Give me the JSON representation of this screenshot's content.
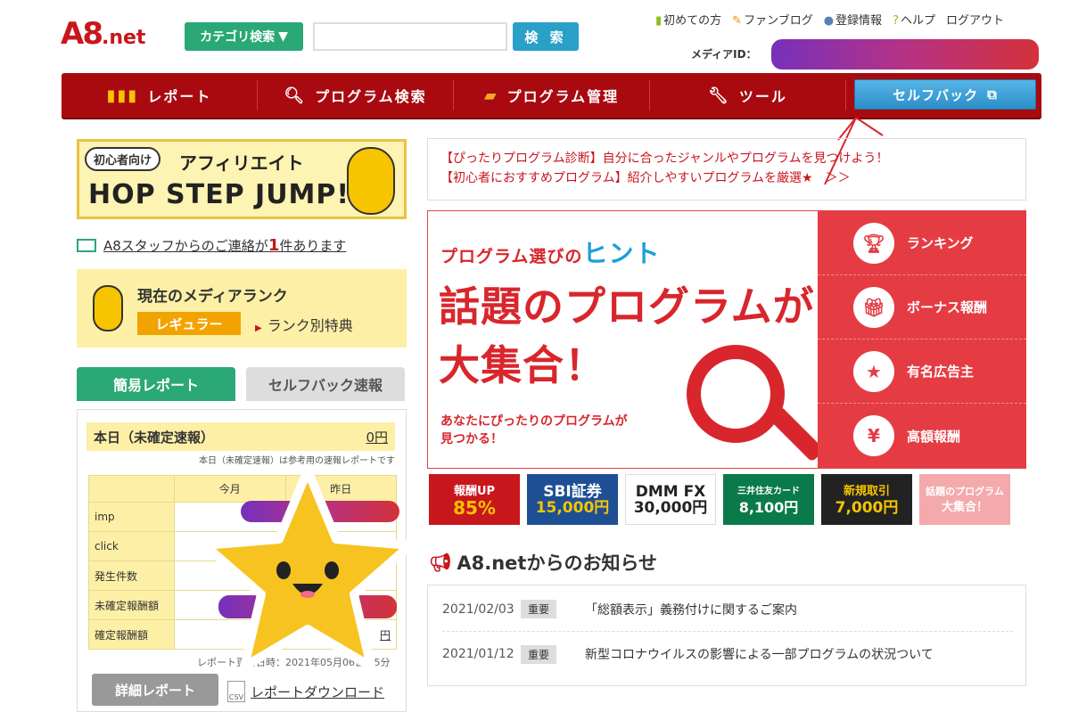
{
  "header": {
    "logo_text": "A8",
    "logo_suffix": ".net",
    "category_button": "カテゴリ検索",
    "search_placeholder": "",
    "search_button": "検 索",
    "top_links": [
      "初めての方",
      "ファンブログ",
      "登録情報",
      "ヘルプ",
      "ログアウト"
    ],
    "media_id_label": "メディアID："
  },
  "nav": {
    "items": [
      "レポート",
      "プログラム検索",
      "プログラム管理",
      "ツール"
    ],
    "selfback": "セルフバック"
  },
  "left": {
    "hop_badge": "初心者向け",
    "hop_title": "アフィリエイト",
    "hop_sub": "HOP STEP JUMP!",
    "mail_text": "A8スタッフからのご連絡が",
    "mail_count": "1",
    "mail_suffix": "件あります",
    "rank_title": "現在のメディアランク",
    "rank_level": "レギュラー",
    "rank_link": "ランク別特典",
    "tab_simple": "簡易レポート",
    "tab_selfback": "セルフバック速報",
    "today_label": "本日（未確定速報）",
    "today_amount": "0円",
    "today_note": "本日（未確定速報）は参考用の速報レポートです",
    "col_today": "今月",
    "col_yesterday": "昨日",
    "rows": [
      "imp",
      "click",
      "発生件数",
      "未確定報酬額",
      "確定報酬額"
    ],
    "last_cell": "円",
    "updated": "レポート更新日時：2021年05月06日 15分",
    "detail_button": "詳細レポート",
    "download": "レポートダウンロード",
    "csv": "CSV"
  },
  "right": {
    "notice1": "【ぴったりプログラム診断】自分に合ったジャンルやプログラムを見つけよう！",
    "notice2": "【初心者におすすめプログラム】紹介しやすいプログラムを厳選★　＞＞",
    "banner_s1": "プログラム選びの",
    "banner_hint": "ヒント",
    "banner_main1": "話題のプログラムが",
    "banner_main2": "大集合！",
    "banner_sub1": "あなたにぴったりのプログラムが",
    "banner_sub2": "見つかる！",
    "banner_menu": [
      "ランキング",
      "ボーナス報酬",
      "有名広告主",
      "高額報酬"
    ],
    "minis": [
      {
        "top": "報酬UP",
        "bottom": "85%"
      },
      {
        "top": "SBI証券",
        "bottom": "15,000円"
      },
      {
        "top": "DMM FX",
        "bottom": "30,000円"
      },
      {
        "top": "三井住友カード",
        "bottom": "8,100円"
      },
      {
        "top": "新規取引",
        "bottom": "7,000円"
      },
      {
        "top": "話題のプログラム",
        "bottom": "大集合！"
      }
    ],
    "news_title": "A8.netからのお知らせ",
    "news": [
      {
        "date": "2021/02/03",
        "tag": "重要",
        "text": "「総額表示」義務付けに関するご案内"
      },
      {
        "date": "2021/01/12",
        "tag": "重要",
        "text": "新型コロナウイルスの影響による一部プログラムの状況ついて"
      }
    ]
  }
}
